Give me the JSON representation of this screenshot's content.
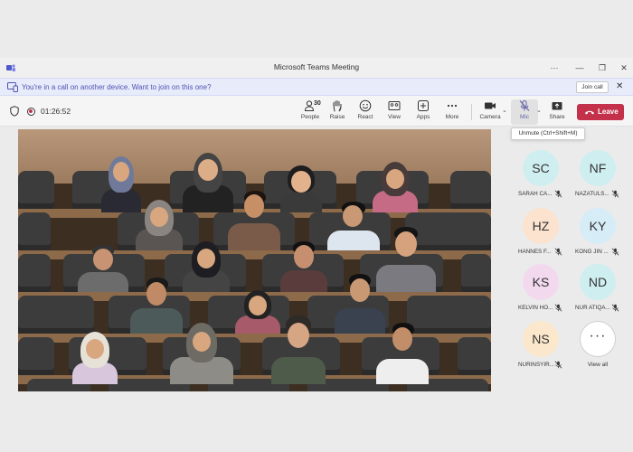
{
  "window": {
    "title": "Microsoft Teams Meeting"
  },
  "banner": {
    "text": "You're in a call on another device. Want to join on this one?",
    "join_label": "Join call"
  },
  "toolbar": {
    "timer": "01:26:52",
    "people_count": "30",
    "buttons": {
      "people": "People",
      "raise": "Raise",
      "react": "React",
      "view": "View",
      "apps": "Apps",
      "more": "More",
      "camera": "Camera",
      "mic": "Mic",
      "share": "Share"
    },
    "leave_label": "Leave"
  },
  "tooltip": "Unmute (Ctrl+Shift+M)",
  "participants": [
    {
      "initials": "SC",
      "name": "SARAH CA...",
      "color": "#cfeef0"
    },
    {
      "initials": "NF",
      "name": "NAZATULS...",
      "color": "#cfeef0"
    },
    {
      "initials": "HZ",
      "name": "HANNES F...",
      "color": "#fbe3cf"
    },
    {
      "initials": "KY",
      "name": "KONG JIN ...",
      "color": "#d6ecf7"
    },
    {
      "initials": "KS",
      "name": "KELVIN HO...",
      "color": "#f3d9ee"
    },
    {
      "initials": "ND",
      "name": "NUR ATIQA...",
      "color": "#cfeef0"
    },
    {
      "initials": "NS",
      "name": "NURINSYIR...",
      "color": "#fbe8cc"
    }
  ],
  "view_all_label": "View all",
  "colors": {
    "accent": "#4f52b2",
    "leave": "#c4314b"
  }
}
